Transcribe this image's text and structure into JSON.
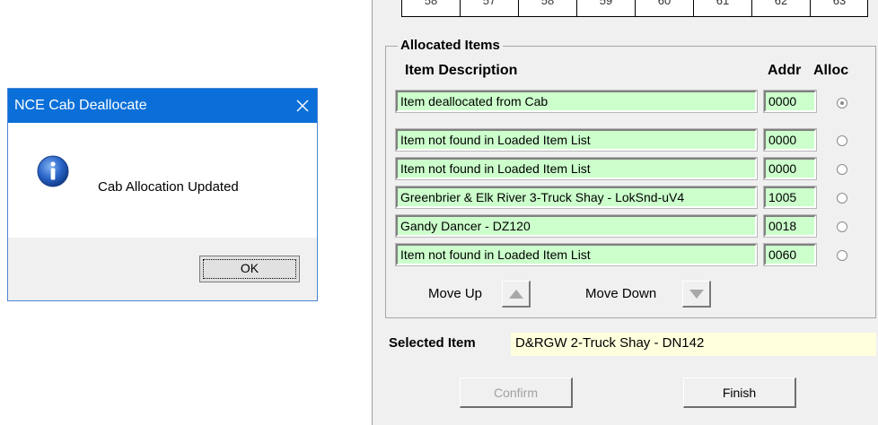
{
  "dialog": {
    "title": "NCE Cab Deallocate",
    "message": "Cab Allocation Updated",
    "ok_label": "OK",
    "icon": "info-icon",
    "close_icon": "close-icon"
  },
  "grid": {
    "cells": [
      "58",
      "57",
      "58",
      "59",
      "60",
      "61",
      "62",
      "63"
    ]
  },
  "allocated": {
    "group_title": "Allocated Items",
    "headers": {
      "description": "Item Description",
      "addr": "Addr",
      "alloc": "Alloc"
    },
    "rows": [
      {
        "description": "Item deallocated from Cab",
        "addr": "0000",
        "alloc_selected": true
      },
      {
        "description": "Item not found in Loaded Item List",
        "addr": "0000",
        "alloc_selected": false
      },
      {
        "description": "Item not found in Loaded Item List",
        "addr": "0000",
        "alloc_selected": false
      },
      {
        "description": "Greenbrier & Elk River 3-Truck Shay - LokSnd-uV4",
        "addr": "1005",
        "alloc_selected": false
      },
      {
        "description": "Gandy Dancer - DZ120",
        "addr": "0018",
        "alloc_selected": false
      },
      {
        "description": "Item not found in Loaded Item List",
        "addr": "0060",
        "alloc_selected": false
      }
    ],
    "move_up_label": "Move Up",
    "move_down_label": "Move Down"
  },
  "selected": {
    "label": "Selected Item",
    "value": "D&RGW 2-Truck Shay - DN142"
  },
  "buttons": {
    "confirm_label": "Confirm",
    "confirm_enabled": false,
    "finish_label": "Finish"
  },
  "colors": {
    "title_bar": "#0a6fd8",
    "field_green": "#ccffcc",
    "selected_yellow": "#ffffdd",
    "panel_bg": "#f0f0f0"
  }
}
